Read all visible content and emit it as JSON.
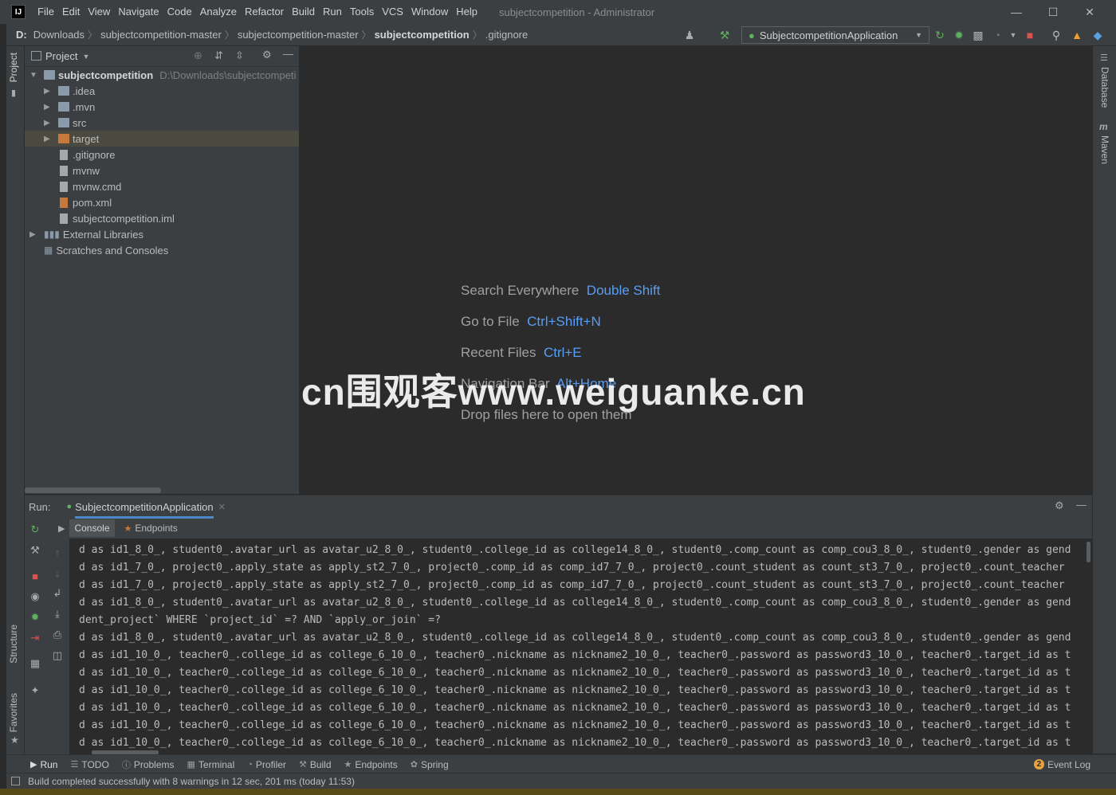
{
  "window": {
    "title": "subjectcompetition - Administrator"
  },
  "menu": [
    "File",
    "Edit",
    "View",
    "Navigate",
    "Code",
    "Analyze",
    "Refactor",
    "Build",
    "Run",
    "Tools",
    "VCS",
    "Window",
    "Help"
  ],
  "breadcrumb": [
    "D:",
    "Downloads",
    "subjectcompetition-master",
    "subjectcompetition-master",
    "subjectcompetition",
    ".gitignore"
  ],
  "toolbar": {
    "run_config": "SubjectcompetitionApplication"
  },
  "left_strip": {
    "project": "Project",
    "structure": "Structure",
    "favorites": "Favorites"
  },
  "right_strip": {
    "database": "Database",
    "maven": "Maven"
  },
  "project": {
    "title": "Project",
    "root": {
      "name": "subjectcompetition",
      "path": "D:\\Downloads\\subjectcompeti"
    },
    "items": [
      {
        "name": ".idea",
        "type": "folder"
      },
      {
        "name": ".mvn",
        "type": "folder"
      },
      {
        "name": "src",
        "type": "folder"
      },
      {
        "name": "target",
        "type": "folder-excluded"
      },
      {
        "name": ".gitignore",
        "type": "file"
      },
      {
        "name": "mvnw",
        "type": "file"
      },
      {
        "name": "mvnw.cmd",
        "type": "file"
      },
      {
        "name": "pom.xml",
        "type": "file"
      },
      {
        "name": "subjectcompetition.iml",
        "type": "file"
      }
    ],
    "external_libraries": "External Libraries",
    "scratches": "Scratches and Consoles"
  },
  "editor": {
    "hints": [
      {
        "label": "Search Everywhere",
        "key": "Double Shift"
      },
      {
        "label": "Go to File",
        "key": "Ctrl+Shift+N"
      },
      {
        "label": "Recent Files",
        "key": "Ctrl+E"
      },
      {
        "label": "Navigation Bar",
        "key": "Alt+Home"
      },
      {
        "label": "Drop files here to open them",
        "key": ""
      }
    ]
  },
  "watermark": "cn围观客www.weiguanke.cn",
  "run": {
    "label": "Run:",
    "tab": "SubjectcompetitionApplication",
    "console_tab": "Console",
    "endpoints_tab": "Endpoints",
    "lines": [
      "d as id1_8_0_, student0_.avatar_url as avatar_u2_8_0_, student0_.college_id as college14_8_0_, student0_.comp_count as comp_cou3_8_0_, student0_.gender as gend",
      "d as id1_7_0_, project0_.apply_state as apply_st2_7_0_, project0_.comp_id as comp_id7_7_0_, project0_.count_student as count_st3_7_0_, project0_.count_teacher",
      "d as id1_7_0_, project0_.apply_state as apply_st2_7_0_, project0_.comp_id as comp_id7_7_0_, project0_.count_student as count_st3_7_0_, project0_.count_teacher",
      "d as id1_8_0_, student0_.avatar_url as avatar_u2_8_0_, student0_.college_id as college14_8_0_, student0_.comp_count as comp_cou3_8_0_, student0_.gender as gend",
      "dent_project` WHERE `project_id` =? AND `apply_or_join` =?",
      "d as id1_8_0_, student0_.avatar_url as avatar_u2_8_0_, student0_.college_id as college14_8_0_, student0_.comp_count as comp_cou3_8_0_, student0_.gender as gend",
      "d as id1_10_0_, teacher0_.college_id as college_6_10_0_, teacher0_.nickname as nickname2_10_0_, teacher0_.password as password3_10_0_, teacher0_.target_id as t",
      "d as id1_10_0_, teacher0_.college_id as college_6_10_0_, teacher0_.nickname as nickname2_10_0_, teacher0_.password as password3_10_0_, teacher0_.target_id as t",
      "d as id1_10_0_, teacher0_.college_id as college_6_10_0_, teacher0_.nickname as nickname2_10_0_, teacher0_.password as password3_10_0_, teacher0_.target_id as t",
      "d as id1_10_0_, teacher0_.college_id as college_6_10_0_, teacher0_.nickname as nickname2_10_0_, teacher0_.password as password3_10_0_, teacher0_.target_id as t",
      "d as id1_10_0_, teacher0_.college_id as college_6_10_0_, teacher0_.nickname as nickname2_10_0_, teacher0_.password as password3_10_0_, teacher0_.target_id as t",
      "d as id1_10_0_, teacher0_.college_id as college_6_10_0_, teacher0_.nickname as nickname2_10_0_, teacher0_.password as password3_10_0_, teacher0_.target_id as t"
    ]
  },
  "bottom_tabs": [
    "Run",
    "TODO",
    "Problems",
    "Terminal",
    "Profiler",
    "Build",
    "Endpoints",
    "Spring"
  ],
  "event_log": {
    "count": "2",
    "label": "Event Log"
  },
  "status": "Build completed successfully with 8 warnings in 12 sec, 201 ms (today 11:53)",
  "colors": {
    "accent": "#589df6",
    "bg": "#2b2b2b",
    "panel": "#3c3f41"
  }
}
